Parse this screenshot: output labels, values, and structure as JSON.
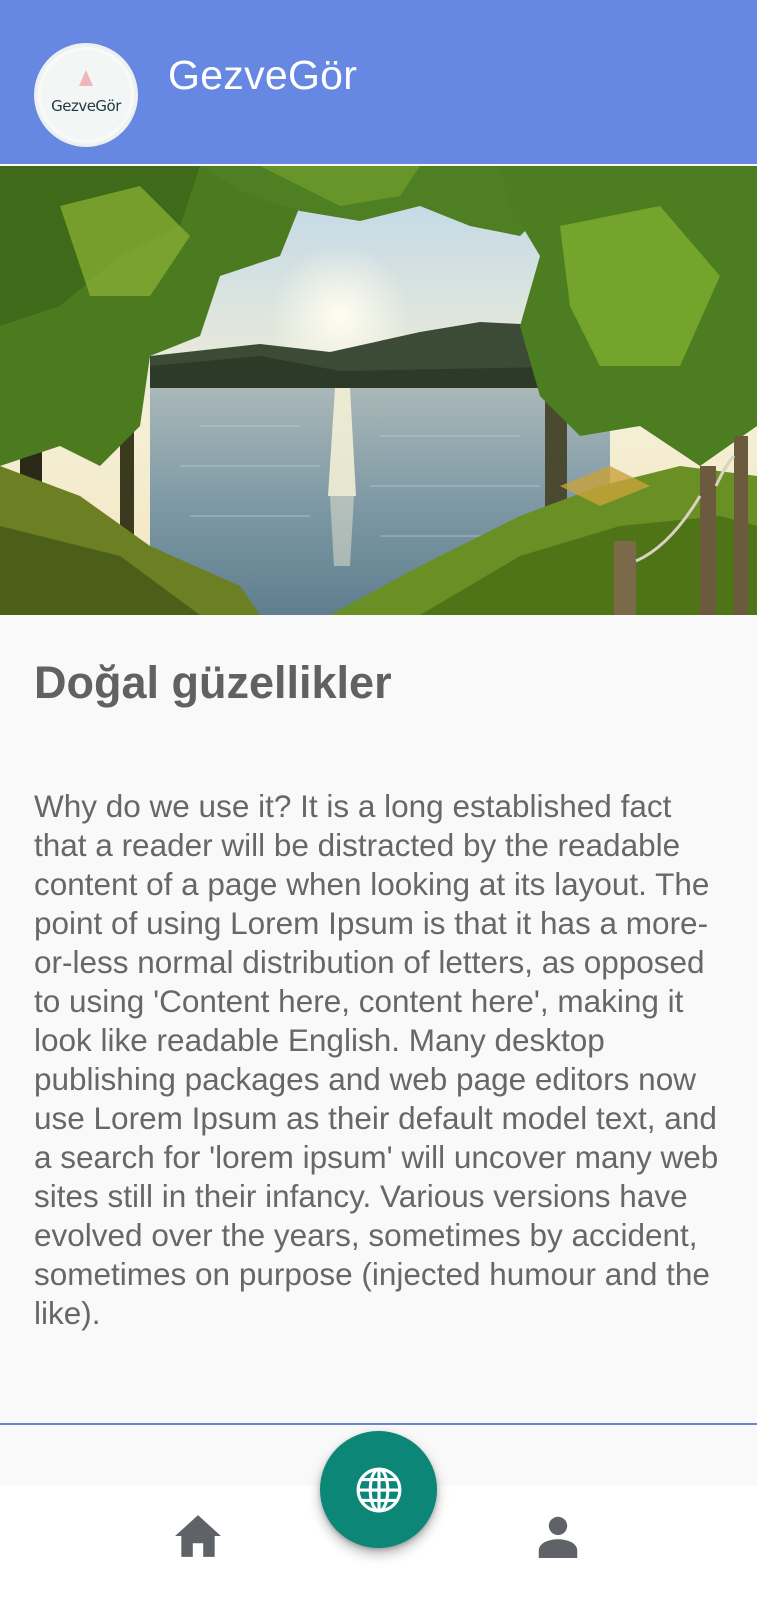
{
  "header": {
    "logo_text": "GezveGör",
    "title": "GezveGör"
  },
  "hero": {
    "icon": "lake-landscape-image"
  },
  "article": {
    "title": "Doğal güzellikler",
    "body": "Why do we use it? It is a long established fact that a reader will be distracted by the readable content of a page when looking at its layout. The point of using Lorem Ipsum is that it has a more-or-less normal distribution of letters, as opposed to using 'Content here, content here', making it look like readable English. Many desktop publishing packages and web page editors now use Lorem Ipsum as their default model text, and a search for 'lorem ipsum' will uncover many web sites still in their infancy. Various versions have evolved over the years, sometimes by accident, sometimes on purpose (injected humour and the like)."
  },
  "bottom_nav": {
    "home_icon": "home-icon",
    "globe_icon": "globe-icon",
    "profile_icon": "person-icon"
  },
  "colors": {
    "app_bar": "#6687e2",
    "fab": "#0c8677",
    "title_text": "#5f6163",
    "body_text": "#666769",
    "nav_icon": "#5f6368"
  }
}
